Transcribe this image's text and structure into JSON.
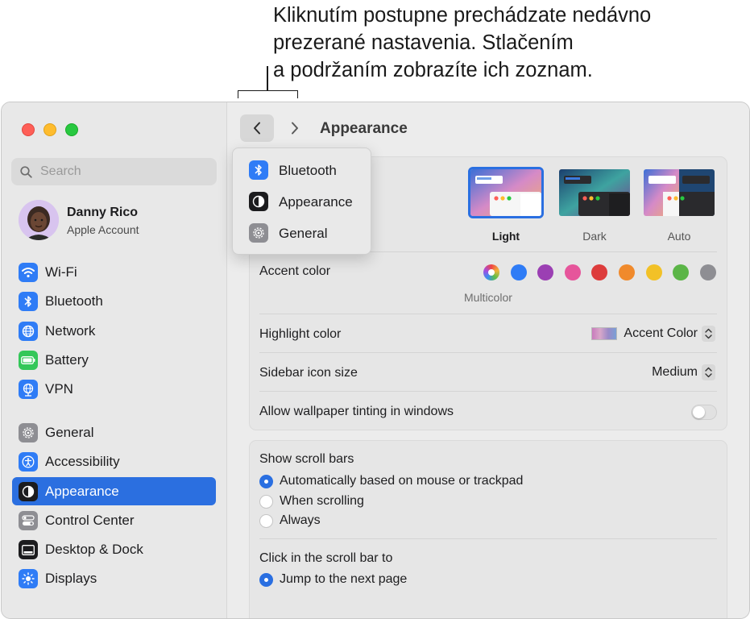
{
  "callout": {
    "line1": "Kliknutím postupne prechádzate nedávno",
    "line2": "prezerané nastavenia. Stlačením",
    "line3": "a podržaním zobrazíte ich zoznam."
  },
  "sidebar": {
    "search_placeholder": "Search",
    "user": {
      "name": "Danny Rico",
      "subtitle": "Apple Account"
    },
    "items": [
      {
        "label": "Wi-Fi",
        "icon": "wifi-icon",
        "color": "#2f7cf6"
      },
      {
        "label": "Bluetooth",
        "icon": "bluetooth-icon",
        "color": "#2f7cf6"
      },
      {
        "label": "Network",
        "icon": "globe-icon",
        "color": "#2f7cf6"
      },
      {
        "label": "Battery",
        "icon": "battery-icon",
        "color": "#34c759"
      },
      {
        "label": "VPN",
        "icon": "vpn-globe-icon",
        "color": "#2f7cf6"
      },
      {
        "label": "General",
        "icon": "gear-icon",
        "color": "#8e8e93"
      },
      {
        "label": "Accessibility",
        "icon": "accessibility-icon",
        "color": "#2f7cf6"
      },
      {
        "label": "Appearance",
        "icon": "appearance-icon",
        "color": "#1c1c1e",
        "selected": true
      },
      {
        "label": "Control Center",
        "icon": "control-center-icon",
        "color": "#8e8e93"
      },
      {
        "label": "Desktop & Dock",
        "icon": "dock-icon",
        "color": "#1c1c1e"
      },
      {
        "label": "Displays",
        "icon": "brightness-icon",
        "color": "#2f7cf6"
      }
    ]
  },
  "toolbar": {
    "title": "Appearance"
  },
  "history_menu": {
    "items": [
      {
        "label": "Bluetooth",
        "icon": "bluetooth-icon"
      },
      {
        "label": "Appearance",
        "icon": "appearance-icon"
      },
      {
        "label": "General",
        "icon": "gear-icon"
      }
    ]
  },
  "appearance": {
    "themes": [
      {
        "label": "Light",
        "selected": true
      },
      {
        "label": "Dark",
        "selected": false
      },
      {
        "label": "Auto",
        "selected": false
      }
    ],
    "accent_label": "Accent color",
    "accent_colors": [
      "multicolor",
      "#2f7cf6",
      "#9b3fb3",
      "#e6559b",
      "#dd3c3c",
      "#f08a2c",
      "#f2c127",
      "#5bb547",
      "#8e8e93"
    ],
    "accent_caption": "Multicolor",
    "highlight_label": "Highlight color",
    "highlight_value": "Accent Color",
    "sidebar_size_label": "Sidebar icon size",
    "sidebar_size_value": "Medium",
    "tinting_label": "Allow wallpaper tinting in windows",
    "tinting_on": false
  },
  "scroll": {
    "show_label": "Show scroll bars",
    "show_options": [
      {
        "label": "Automatically based on mouse or trackpad",
        "selected": true
      },
      {
        "label": "When scrolling",
        "selected": false
      },
      {
        "label": "Always",
        "selected": false
      }
    ],
    "click_label": "Click in the scroll bar to",
    "click_options": [
      {
        "label": "Jump to the next page",
        "selected": true
      }
    ]
  }
}
